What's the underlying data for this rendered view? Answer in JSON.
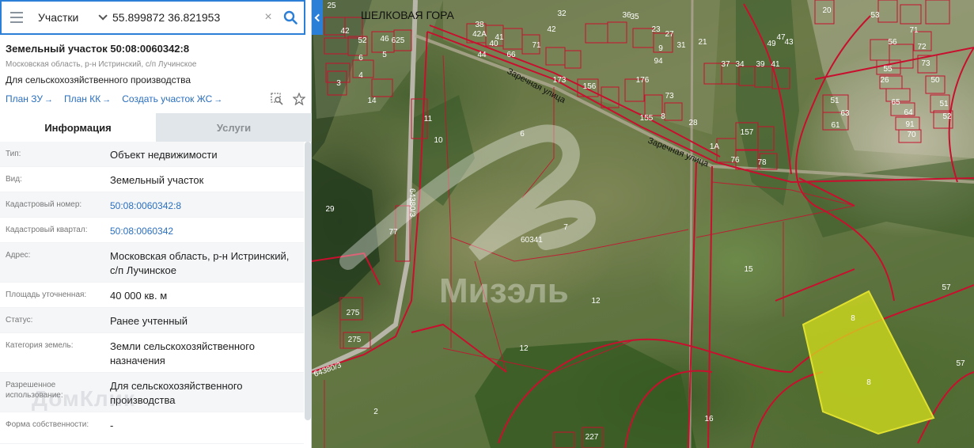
{
  "search": {
    "layer": "Участки",
    "query": "55.899872 36.821953",
    "clear_glyph": "×"
  },
  "parcel": {
    "title": "Земельный участок 50:08:0060342:8",
    "location": "Московская область, р-н Истринский, с/п Лучинское",
    "usage": "Для сельскохозяйственного производства",
    "links": [
      {
        "label": "План ЗУ",
        "arrow": "→"
      },
      {
        "label": "План КК",
        "arrow": "→"
      },
      {
        "label": "Создать участок ЖС",
        "arrow": "→"
      }
    ],
    "icons": [
      "search-area-icon",
      "star-icon"
    ]
  },
  "tabs": [
    {
      "label": "Информация",
      "active": true
    },
    {
      "label": "Услуги",
      "active": false
    }
  ],
  "info_rows": [
    {
      "key": "Тип:",
      "value": "Объект недвижимости",
      "link": false
    },
    {
      "key": "Вид:",
      "value": "Земельный участок",
      "link": false
    },
    {
      "key": "Кадастровый номер:",
      "value": "50:08:0060342:8",
      "link": true
    },
    {
      "key": "Кадастровый квартал:",
      "value": "50:08:0060342",
      "link": true
    },
    {
      "key": "Адрес:",
      "value": "Московская область, р-н Истринский, с/п Лучинское",
      "link": false
    },
    {
      "key": "Площадь уточненная:",
      "value": "40 000 кв. м",
      "link": false
    },
    {
      "key": "Статус:",
      "value": "Ранее учтенный",
      "link": false
    },
    {
      "key": "Категория земель:",
      "value": "Земли сельскохозяйственного назначения",
      "link": false
    },
    {
      "key": "Разрешенное использование:",
      "value": "Для сельскохозяйственного производства",
      "link": false
    },
    {
      "key": "Форма собственности:",
      "value": "-",
      "link": false
    }
  ],
  "watermark_panel": "ДомКлик",
  "map": {
    "town": "ШЕЛКОВАЯ ГОРА",
    "streets": [
      "Заречная улица",
      "Заречная улица"
    ],
    "quarter_labels": [
      "64380/3",
      "64380/3",
      "60341"
    ],
    "watermark": "Мизэль",
    "plot_numbers": [
      "6",
      "7",
      "12",
      "12",
      "15",
      "16",
      "2",
      "57",
      "57",
      "8",
      "8",
      "14",
      "10",
      "11",
      "29",
      "77",
      "275",
      "275",
      "227",
      "25",
      "3",
      "4",
      "5",
      "6",
      "46",
      "42",
      "52",
      "625",
      "44",
      "38",
      "41",
      "40",
      "66",
      "42A",
      "71",
      "42",
      "32",
      "36",
      "35",
      "23",
      "27",
      "21",
      "31",
      "37",
      "34",
      "39",
      "41",
      "43",
      "49",
      "47",
      "51",
      "63",
      "61",
      "65",
      "64",
      "91",
      "70",
      "71",
      "72",
      "73",
      "50",
      "51",
      "52",
      "53",
      "56",
      "55",
      "26",
      "20",
      "1A",
      "28",
      "157",
      "76",
      "78",
      "173",
      "156",
      "176",
      "155",
      "8",
      "9",
      "94",
      "73",
      "78",
      "108",
      "159",
      "16"
    ],
    "colors": {
      "boundary": "#c8102e",
      "selected_fill": "#d7e21c",
      "selected_stroke": "#e0e030"
    }
  }
}
